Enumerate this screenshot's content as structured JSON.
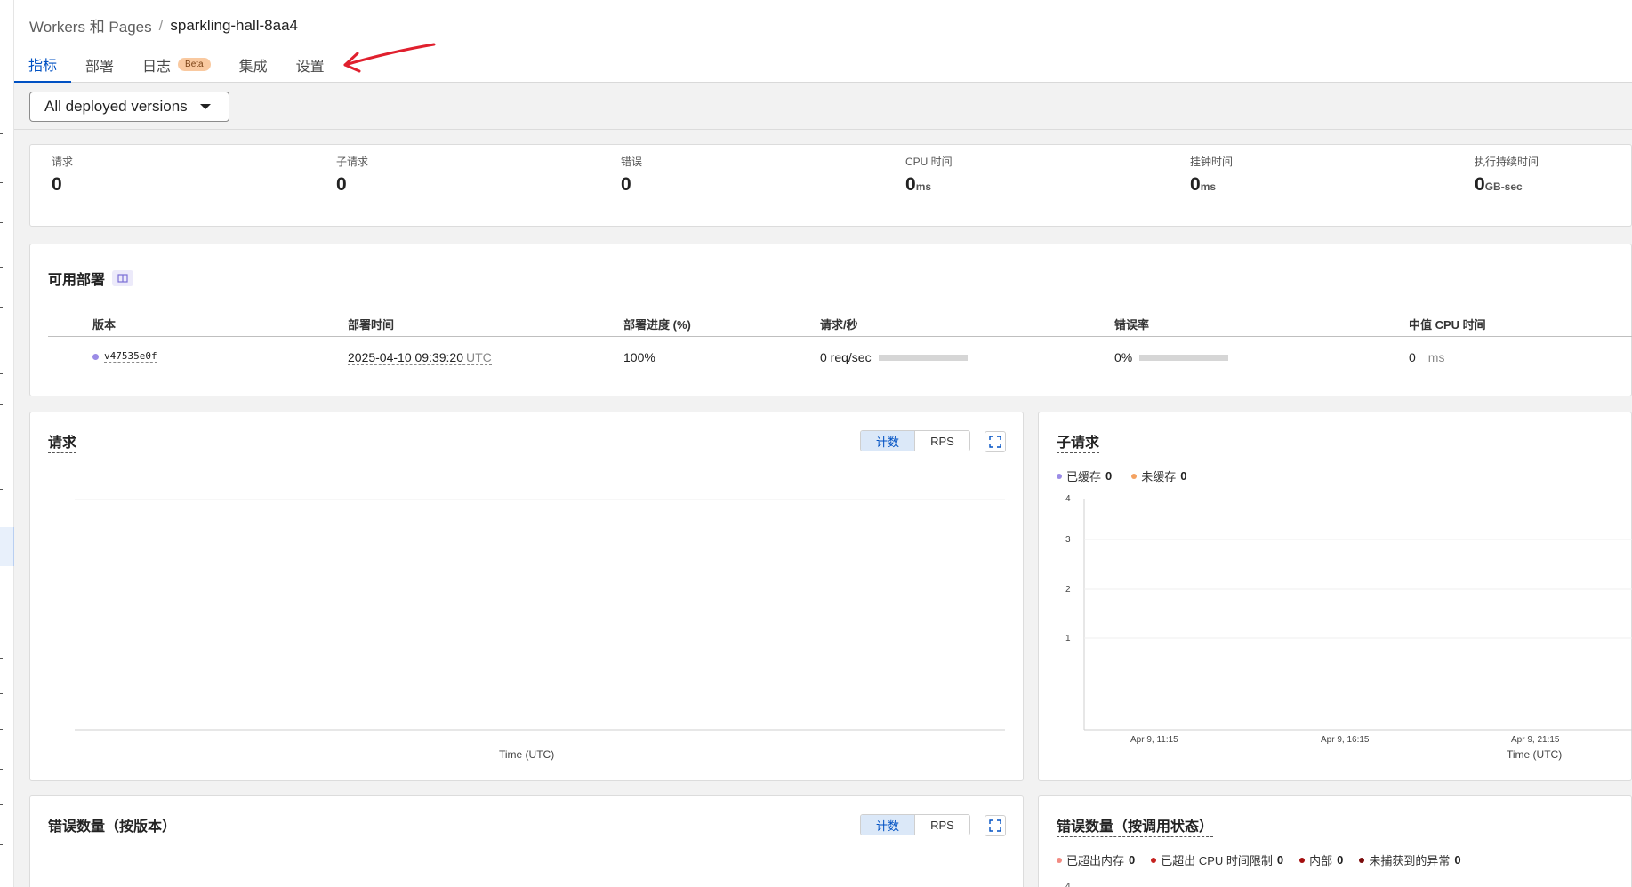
{
  "breadcrumb": {
    "parent": "Workers 和 Pages",
    "separator": "/",
    "current": "sparkling-hall-8aa4"
  },
  "tabs": [
    {
      "label": "指标",
      "active": true
    },
    {
      "label": "部署"
    },
    {
      "label": "日志",
      "badge": "Beta"
    },
    {
      "label": "集成"
    },
    {
      "label": "设置"
    }
  ],
  "filter": {
    "version_select": "All deployed versions"
  },
  "metrics": [
    {
      "label": "请求",
      "value": "0",
      "unit": ""
    },
    {
      "label": "子请求",
      "value": "0",
      "unit": ""
    },
    {
      "label": "错误",
      "value": "0",
      "unit": ""
    },
    {
      "label": "CPU 时间",
      "value": "0",
      "unit": "ms"
    },
    {
      "label": "挂钟时间",
      "value": "0",
      "unit": "ms"
    },
    {
      "label": "执行持续时间",
      "value": "0",
      "unit": "GB-sec"
    }
  ],
  "deployments": {
    "title": "可用部署",
    "headers": [
      "版本",
      "部署时间",
      "部署进度 (%)",
      "请求/秒",
      "错误率",
      "中值 CPU 时间"
    ],
    "row": {
      "version": "v47535e0f",
      "time": "2025-04-10 09:39:20",
      "tz": "UTC",
      "progress": "100%",
      "rps": "0 req/sec",
      "error_rate": "0%",
      "cpu_value": "0",
      "cpu_unit": "ms"
    }
  },
  "requests_chart": {
    "title": "请求",
    "toggle": [
      "计数",
      "RPS"
    ],
    "xlabel": "Time (UTC)"
  },
  "subrequests_chart": {
    "title": "子请求",
    "legend": [
      {
        "label": "已缓存",
        "value": "0",
        "color": "#9b8ce6"
      },
      {
        "label": "未缓存",
        "value": "0",
        "color": "#f4a261"
      }
    ],
    "yticks": [
      "4",
      "3",
      "2",
      "1"
    ],
    "xticks": [
      "Apr 9, 11:15",
      "Apr 9, 16:15",
      "Apr 9, 21:15"
    ],
    "xlabel": "Time (UTC)"
  },
  "errors_by_version": {
    "title": "错误数量（按版本）",
    "toggle": [
      "计数",
      "RPS"
    ]
  },
  "errors_by_status": {
    "title": "错误数量（按调用状态）",
    "legend": [
      {
        "label": "已超出内存",
        "value": "0",
        "color": "#f28b82"
      },
      {
        "label": "已超出 CPU 时间限制",
        "value": "0",
        "color": "#c5221f"
      },
      {
        "label": "内部",
        "value": "0",
        "color": "#a50e0e"
      },
      {
        "label": "未捕获到的异常",
        "value": "0",
        "color": "#7a0b0b"
      }
    ],
    "ytick_top": "4"
  }
}
